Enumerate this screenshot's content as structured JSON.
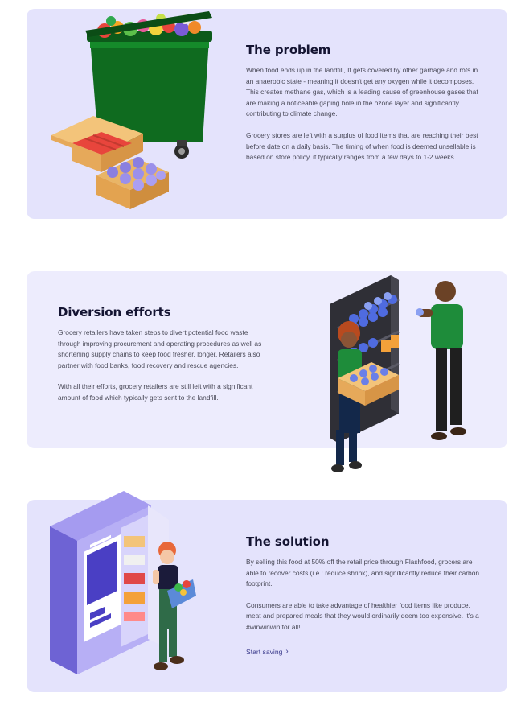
{
  "sections": {
    "problem": {
      "title": "The problem",
      "paragraphs": [
        "When food ends up in the landfill, It gets covered by other garbage and rots in an anaerobic state - meaning it doesn't get any oxygen while it decomposes. This creates methane gas, which is a leading cause of greenhouse gases that are making a noticeable gaping hole in the ozone layer and significantly contributing to climate change.",
        "Grocery stores are left with a surplus of food items that are reaching their best before date on a daily basis. The timing of when food is deemed unsellable is based on store policy, it typically ranges from a few days to 1-2 weeks."
      ]
    },
    "diversion": {
      "title": "Diversion efforts",
      "paragraphs": [
        "Grocery retailers have taken steps to divert potential food waste through improving procurement and operating procedures as well as shortening supply chains to keep food fresher, longer. Retailers also partner with food banks, food recovery and rescue agencies.",
        "With all their efforts, grocery retailers are still left with a significant amount of food which typically gets sent to the landfill."
      ]
    },
    "solution": {
      "title": "The solution",
      "paragraphs": [
        "By selling this food at 50% off the retail price through Flashfood, grocers are able to recover costs (i.e.: reduce shrink), and significantly reduce their carbon footprint.",
        "Consumers are able to take advantage of healthier food items like produce, meat and prepared meals that they would ordinarily deem too expensive. It's a #winwinwin for all!"
      ],
      "cta_label": "Start saving"
    }
  },
  "icons": {
    "cta": "chevron-right-icon"
  },
  "colors": {
    "card_bg": "#e4e3fc",
    "card_bg_alt": "#edecfd",
    "title": "#141432",
    "link": "#3b3b8c",
    "bin_green": "#0f6b1f",
    "shirt_green": "#1e8c3a"
  }
}
